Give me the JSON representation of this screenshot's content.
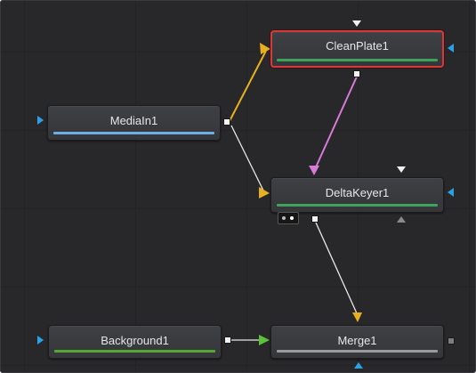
{
  "node_editor": {
    "nodes": {
      "cleanplate": {
        "label": "CleanPlate1",
        "bar_color": "#3ca35a",
        "selected": true
      },
      "mediain": {
        "label": "MediaIn1",
        "bar_color": "#6ab0e6",
        "selected": false
      },
      "deltakeyer": {
        "label": "DeltaKeyer1",
        "bar_color": "#3ca35a",
        "selected": false
      },
      "background": {
        "label": "Background1",
        "bar_color": "#54a832",
        "selected": false
      },
      "merge": {
        "label": "Merge1",
        "bar_color": "#9a9a9a",
        "selected": false
      }
    },
    "connections": [
      {
        "from": "MediaIn1",
        "to": "CleanPlate1",
        "input": "yellow",
        "color": "#e8b021"
      },
      {
        "from": "MediaIn1",
        "to": "DeltaKeyer1",
        "input": "yellow",
        "color": "#e8e8e8"
      },
      {
        "from": "CleanPlate1",
        "to": "DeltaKeyer1",
        "input": "magenta",
        "color": "#d77ad8"
      },
      {
        "from": "DeltaKeyer1",
        "to": "Merge1",
        "input": "yellow",
        "color": "#e8e8e8"
      },
      {
        "from": "Background1",
        "to": "Merge1",
        "input": "green",
        "color": "#e8e8e8"
      }
    ],
    "colors": {
      "canvas": "#28282b",
      "input_blue": "#2aa2e8",
      "input_yellow": "#e8b021",
      "input_green": "#5cc23a",
      "input_magenta": "#d77ad8",
      "selection": "#d43a3a"
    },
    "icons": {
      "mediain_in": "input-arrow-icon",
      "cleanplate_top": "mask-input-icon",
      "deltakeyer_badge": "view-indicator-icon"
    }
  }
}
